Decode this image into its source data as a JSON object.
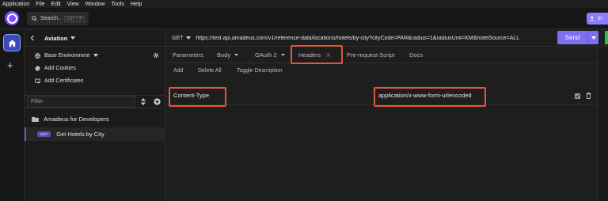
{
  "menubar": {
    "items": [
      "Application",
      "File",
      "Edit",
      "View",
      "Window",
      "Tools",
      "Help"
    ]
  },
  "header": {
    "search_label": "Search..",
    "search_shortcut": "Ctrl + P",
    "invite_label": "In"
  },
  "sidebar": {
    "project": "Aviation",
    "environment": "Base Environment",
    "add_cookies": "Add Cookies",
    "add_certificates": "Add Certificates",
    "filter_placeholder": "Filter",
    "folder": "Amadeus for Developers",
    "request": {
      "method": "GET",
      "name": "Get Hotels by City"
    }
  },
  "request": {
    "method": "GET",
    "url": "https://test.api.amadeus.com/v1/reference-data/locations/hotels/by-city?cityCode=PAR&radius=1&radiusUnit=KM&hotelSource=ALL",
    "send_label": "Send"
  },
  "tabs": {
    "parameters": "Parameters",
    "body": "Body",
    "auth": "OAuth 2",
    "headers": "Headers",
    "headers_count": "1",
    "pre_request": "Pre-request Script",
    "docs": "Docs"
  },
  "headers_toolbar": {
    "add": "Add",
    "delete_all": "Delete All",
    "toggle_description": "Toggle Description"
  },
  "header_row": {
    "name": "Content-Type",
    "value": "application/x-www-form-urlencoded"
  },
  "colors": {
    "accent": "#7d6ff0",
    "highlight": "#e0573e",
    "active_rail": "#3a4bb8"
  }
}
